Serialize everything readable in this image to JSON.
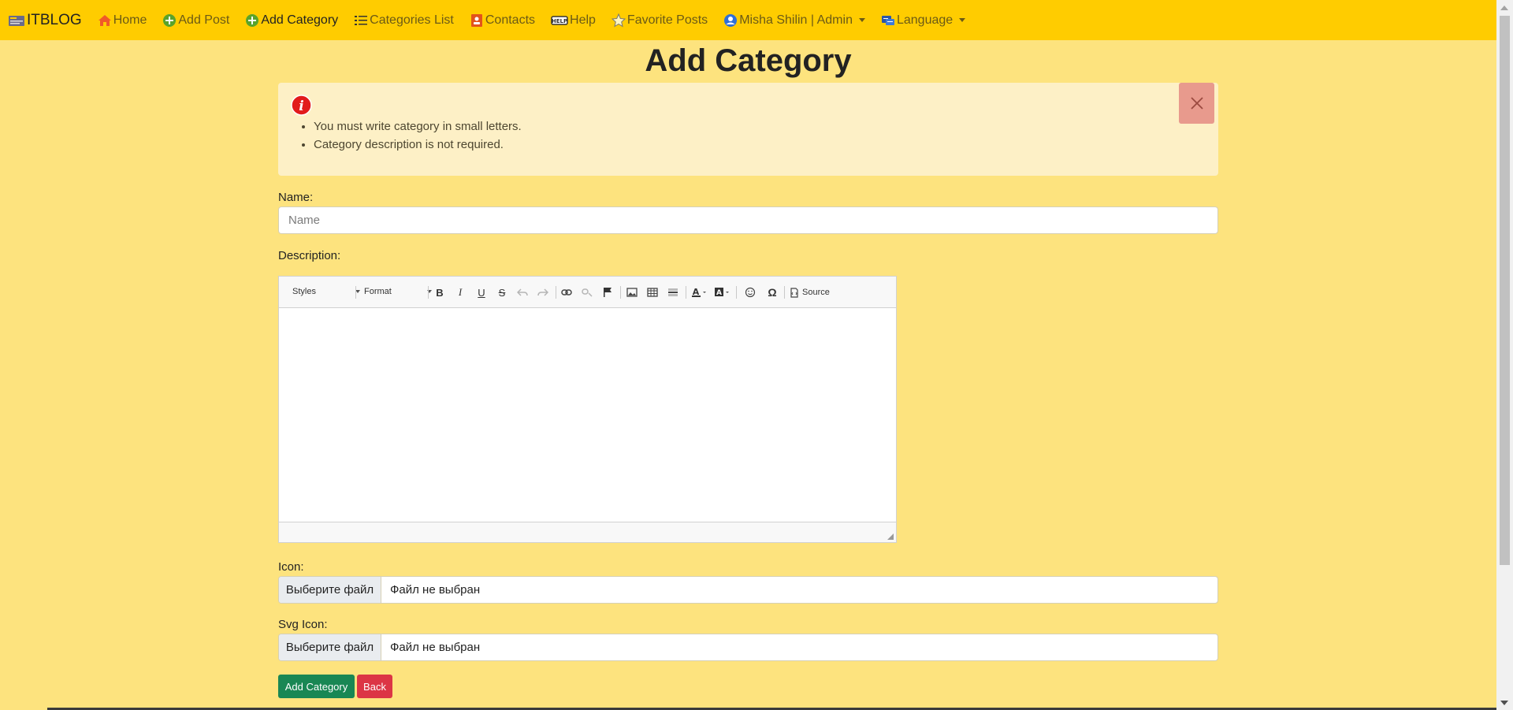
{
  "nav": {
    "brand": "ITBLOG",
    "items": [
      {
        "label": "Home",
        "icon": "home-icon"
      },
      {
        "label": "Add Post",
        "icon": "plus-circle-icon"
      },
      {
        "label": "Add Category",
        "icon": "plus-circle-icon",
        "active": true
      },
      {
        "label": "Categories List",
        "icon": "list-icon"
      },
      {
        "label": "Contacts",
        "icon": "contacts-icon"
      },
      {
        "label": "Help",
        "icon": "help-icon"
      },
      {
        "label": "Favorite Posts",
        "icon": "star-icon"
      },
      {
        "label": "Misha Shilin | Admin",
        "icon": "user-icon",
        "dropdown": true
      },
      {
        "label": "Language",
        "icon": "language-icon",
        "dropdown": true
      }
    ]
  },
  "page": {
    "title": "Add Category"
  },
  "alert": {
    "items": [
      "You must write category in small letters.",
      "Category description is not required."
    ]
  },
  "form": {
    "name_label": "Name:",
    "name_placeholder": "Name",
    "name_value": "",
    "description_label": "Description:",
    "icon_label": "Icon:",
    "svg_icon_label": "Svg Icon:",
    "file_button": "Выберите файл",
    "file_status": "Файл не выбран",
    "submit_label": "Add Category",
    "back_label": "Back"
  },
  "editor": {
    "styles_label": "Styles",
    "format_label": "Format",
    "source_label": "Source"
  },
  "colors": {
    "navbar": "#ffcc00",
    "background": "#fde37e",
    "alert": "#fdf0c6",
    "submit": "#198754",
    "back": "#dc3545"
  }
}
